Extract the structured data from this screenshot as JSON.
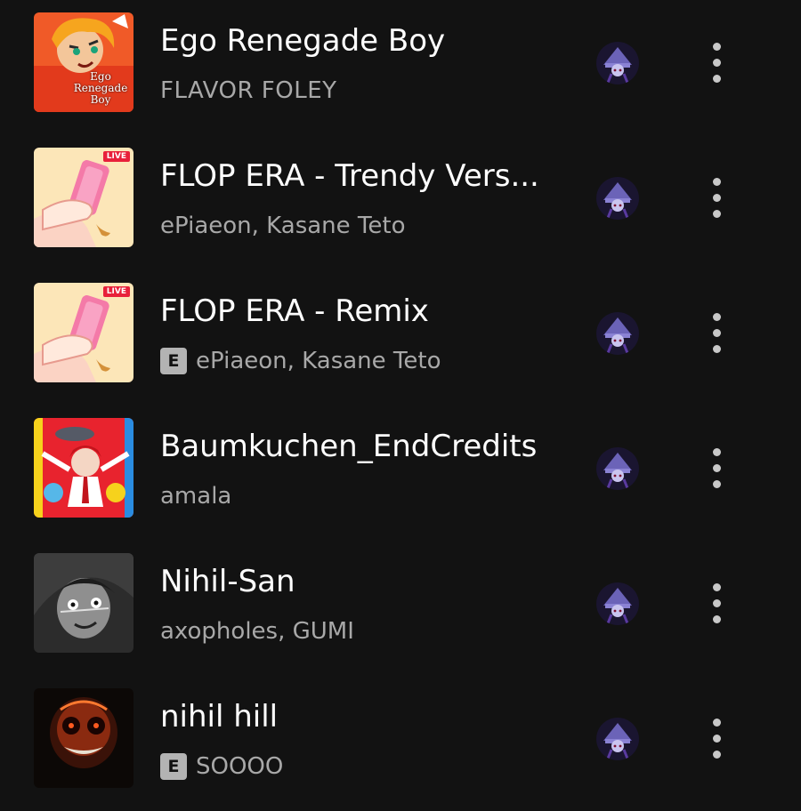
{
  "tracks": [
    {
      "title": "Ego Renegade Boy",
      "artist": "FLAVOR FOLEY",
      "explicit": false,
      "cover_text": [
        "Ego",
        "Renegade",
        "Boy"
      ]
    },
    {
      "title": "FLOP ERA - Trendy Vers...",
      "artist": "ePiaeon, Kasane Teto",
      "explicit": false,
      "cover_badge": "LIVE"
    },
    {
      "title": "FLOP ERA - Remix",
      "artist": "ePiaeon, Kasane Teto",
      "explicit": true,
      "explicit_label": "E",
      "cover_badge": "LIVE"
    },
    {
      "title": "Baumkuchen_EndCredits",
      "artist": "amala",
      "explicit": false
    },
    {
      "title": "Nihil-San",
      "artist": "axopholes, GUMI",
      "explicit": false
    },
    {
      "title": "nihil hill",
      "artist": "SOOOO",
      "explicit": true,
      "explicit_label": "E"
    }
  ],
  "colors": {
    "background": "#121212",
    "title": "#ffffff",
    "subtitle": "#a8a8a8",
    "explicit_badge": "#b3b3b3",
    "more_dots": "#c8c8c8"
  },
  "icons": {
    "avatar": "user-avatar-icon",
    "more": "more-options-icon",
    "explicit": "explicit-badge-icon"
  }
}
